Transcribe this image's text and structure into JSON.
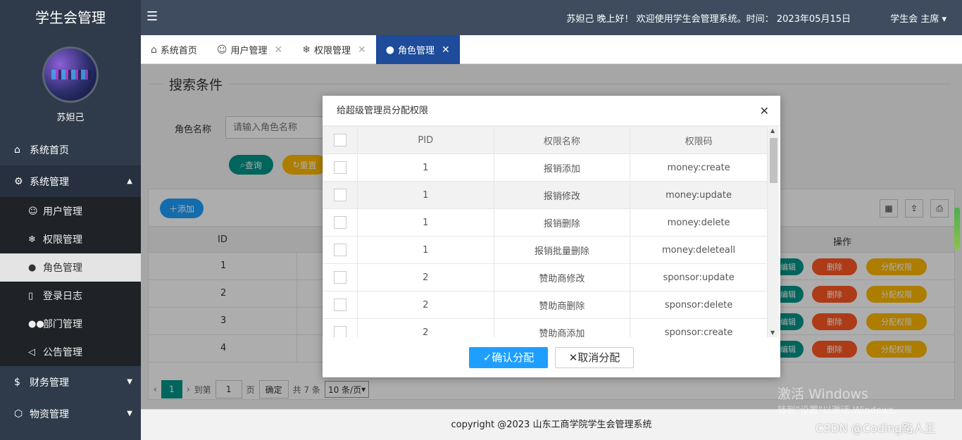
{
  "app": {
    "title": "学生会管理"
  },
  "user": {
    "name": "苏妲己"
  },
  "header": {
    "welcome": "苏妲己 晚上好！ 欢迎使用学生会管理系统。时间： 2023年05月15日",
    "role": "学生会 主席"
  },
  "sidebar": {
    "home": "系统首页",
    "system": "系统管理",
    "sub": [
      "用户管理",
      "权限管理",
      "角色管理",
      "登录日志",
      "部门管理",
      "公告管理"
    ],
    "finance": "财务管理",
    "material": "物资管理"
  },
  "tabs": [
    {
      "label": "系统首页"
    },
    {
      "label": "用户管理"
    },
    {
      "label": "权限管理"
    },
    {
      "label": "角色管理"
    }
  ],
  "search": {
    "legend": "搜索条件",
    "label": "角色名称",
    "placeholder": "请输入角色名称",
    "query": "查询",
    "reset": "重置"
  },
  "table": {
    "add": "添加",
    "col_id": "ID",
    "col_op": "操作",
    "rows": [
      "1",
      "2",
      "3",
      "4"
    ],
    "op_edit": "编辑",
    "op_delete": "删除",
    "op_assign": "分配权限"
  },
  "pager": {
    "current": "1",
    "goto": "到第",
    "page_input": "1",
    "page_unit": "页",
    "confirm": "确定",
    "total": "共 7 条",
    "per_page": "10 条/页"
  },
  "modal": {
    "title": "给超级管理员分配权限",
    "headers": [
      "PID",
      "权限名称",
      "权限码"
    ],
    "rows": [
      {
        "pid": "1",
        "name": "报销添加",
        "code": "money:create"
      },
      {
        "pid": "1",
        "name": "报销修改",
        "code": "money:update"
      },
      {
        "pid": "1",
        "name": "报销删除",
        "code": "money:delete"
      },
      {
        "pid": "1",
        "name": "报销批量删除",
        "code": "money:deleteall"
      },
      {
        "pid": "2",
        "name": "赞助商修改",
        "code": "sponsor:update"
      },
      {
        "pid": "2",
        "name": "赞助商删除",
        "code": "sponsor:delete"
      },
      {
        "pid": "2",
        "name": "赞助商添加",
        "code": "sponsor:create"
      }
    ],
    "confirm": "确认分配",
    "cancel": "取消分配"
  },
  "footer": {
    "copyright": "copyright @2023 山东工商学院学生会管理系统"
  },
  "watermark": {
    "line1": "激活 Windows",
    "line2": "转到\"设置\"以激活 Windows。",
    "csdn": "CSDN @Coding路人王"
  }
}
